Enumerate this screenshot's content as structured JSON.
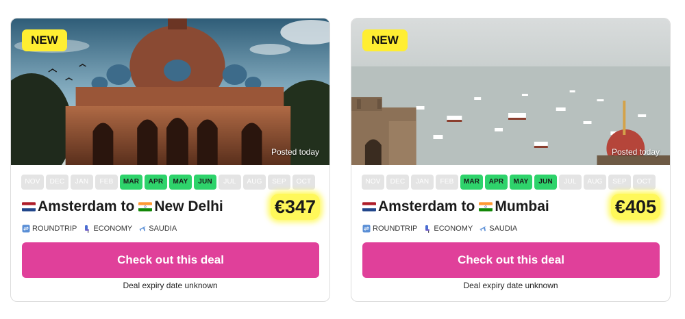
{
  "cards": [
    {
      "badge": "NEW",
      "posted": "Posted today",
      "image": "delhi-tomb-photo",
      "months": [
        {
          "label": "NOV",
          "on": false
        },
        {
          "label": "DEC",
          "on": false
        },
        {
          "label": "JAN",
          "on": false
        },
        {
          "label": "FEB",
          "on": false
        },
        {
          "label": "MAR",
          "on": true
        },
        {
          "label": "APR",
          "on": true
        },
        {
          "label": "MAY",
          "on": true
        },
        {
          "label": "JUN",
          "on": true
        },
        {
          "label": "JUL",
          "on": false
        },
        {
          "label": "AUG",
          "on": false
        },
        {
          "label": "SEP",
          "on": false
        },
        {
          "label": "OCT",
          "on": false
        }
      ],
      "origin": "Amsterdam",
      "connector": "to",
      "destination": "New Delhi",
      "origin_flag": "netherlands-flag",
      "destination_flag": "india-flag",
      "price": "€347",
      "trip_type": "ROUNDTRIP",
      "cabin": "ECONOMY",
      "airline": "SAUDIA",
      "cta": "Check out this deal",
      "expiry": "Deal expiry date unknown"
    },
    {
      "badge": "NEW",
      "posted": "Posted today",
      "image": "mumbai-harbour-photo",
      "months": [
        {
          "label": "NOV",
          "on": false
        },
        {
          "label": "DEC",
          "on": false
        },
        {
          "label": "JAN",
          "on": false
        },
        {
          "label": "FEB",
          "on": false
        },
        {
          "label": "MAR",
          "on": true
        },
        {
          "label": "APR",
          "on": true
        },
        {
          "label": "MAY",
          "on": true
        },
        {
          "label": "JUN",
          "on": true
        },
        {
          "label": "JUL",
          "on": false
        },
        {
          "label": "AUG",
          "on": false
        },
        {
          "label": "SEP",
          "on": false
        },
        {
          "label": "OCT",
          "on": false
        }
      ],
      "origin": "Amsterdam",
      "connector": "to",
      "destination": "Mumbai",
      "origin_flag": "netherlands-flag",
      "destination_flag": "india-flag",
      "price": "€405",
      "trip_type": "ROUNDTRIP",
      "cabin": "ECONOMY",
      "airline": "SAUDIA",
      "cta": "Check out this deal",
      "expiry": "Deal expiry date unknown"
    }
  ],
  "colors": {
    "badge": "#ffee32",
    "month_active": "#2ed36b",
    "month_inactive": "#e4e4e4",
    "price_highlight": "#fff85a",
    "cta": "#e0409a"
  }
}
